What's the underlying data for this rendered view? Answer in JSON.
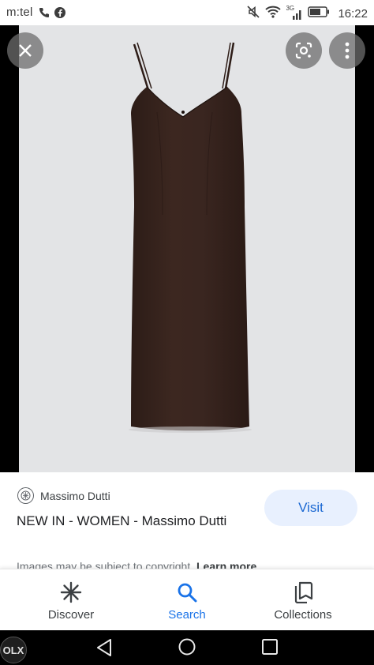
{
  "status_bar": {
    "carrier": "m:tel",
    "network_type": "3G",
    "time": "16:22",
    "icons": [
      "phone-icon",
      "facebook-icon",
      "mute-icon",
      "wifi-icon",
      "signal-icon",
      "battery-icon"
    ]
  },
  "viewer": {
    "overlay_buttons": [
      "close-icon",
      "google-lens-icon",
      "more-vert-icon"
    ],
    "image_subject": "brown slip dress"
  },
  "result": {
    "source_name": "Massimo Dutti",
    "title": "NEW IN - WOMEN - Massimo Dutti",
    "visit_label": "Visit",
    "copyright_text": "Images may be subject to copyright.",
    "learn_more_label": "Learn more"
  },
  "bottom_nav": {
    "items": [
      {
        "label": "Discover",
        "icon": "asterisk-icon",
        "active": false
      },
      {
        "label": "Search",
        "icon": "search-icon",
        "active": true
      },
      {
        "label": "Collections",
        "icon": "collections-icon",
        "active": false
      }
    ]
  },
  "system_nav": {
    "overlay_app": "OLX",
    "buttons": [
      "back-icon",
      "home-icon",
      "recents-icon"
    ]
  },
  "colors": {
    "accent": "#1a73e8",
    "visit_bg": "#e8f0fe",
    "dress": "#3a2620",
    "photo_bg": "#e3e4e6"
  }
}
